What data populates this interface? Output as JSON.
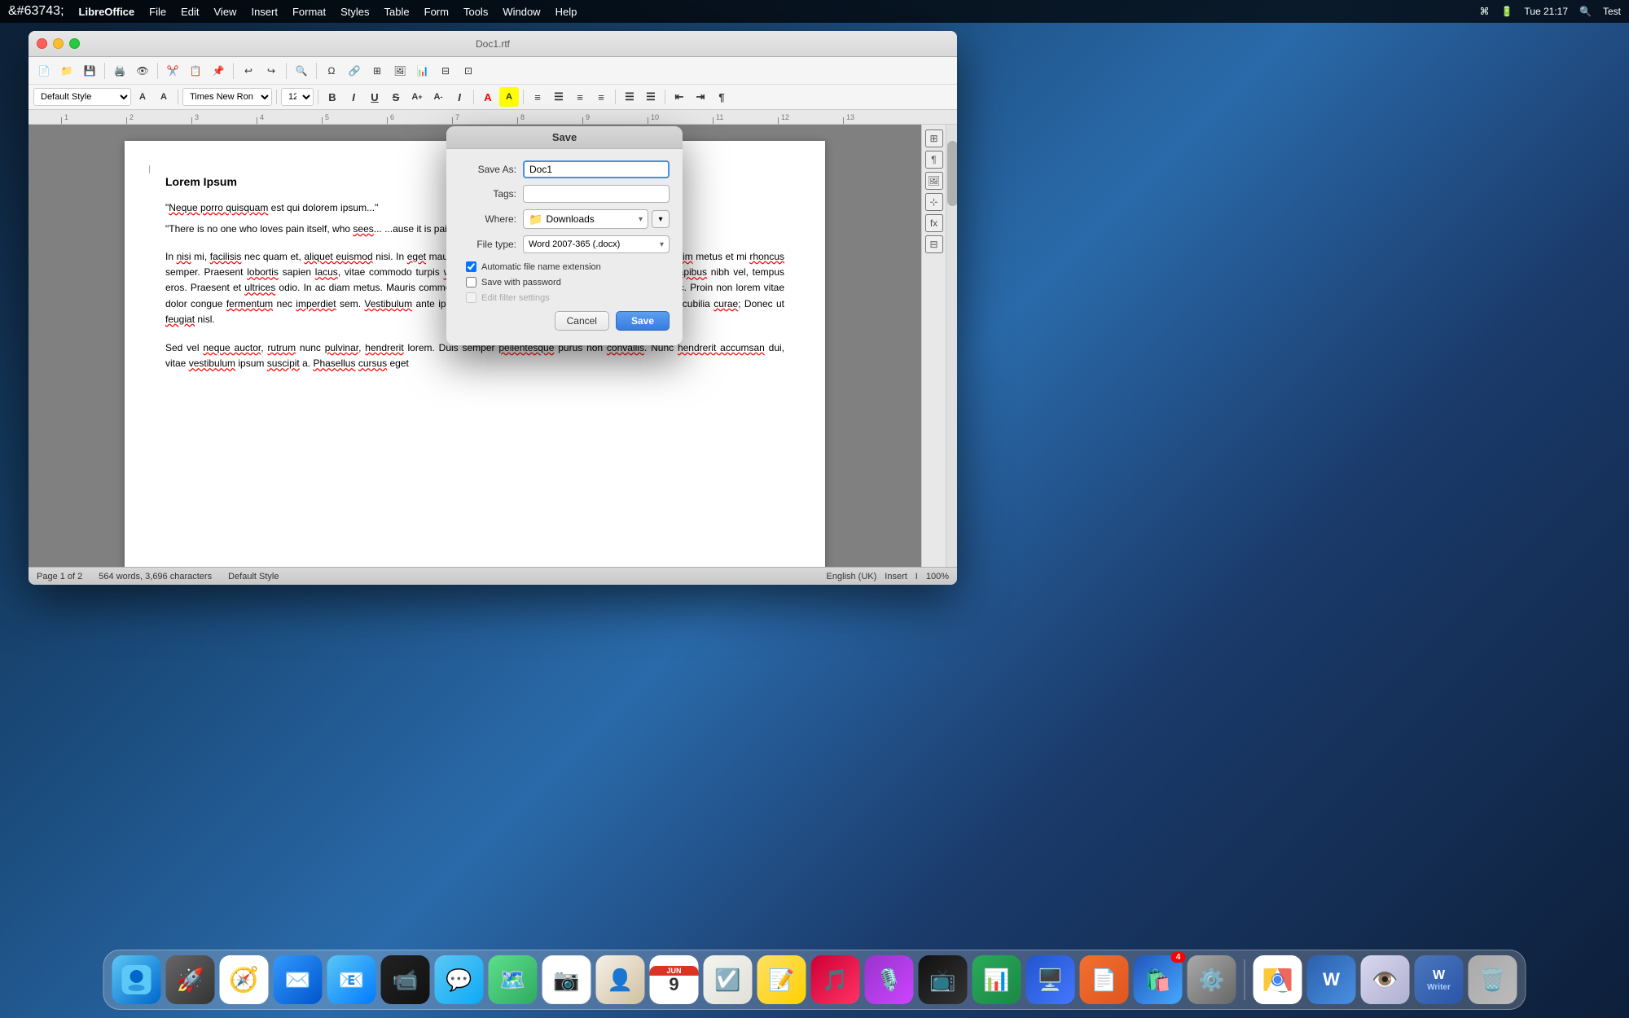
{
  "menu_bar": {
    "apple": "&#63743;",
    "app_name": "LibreOffice",
    "menus": [
      "File",
      "Edit",
      "View",
      "Insert",
      "Format",
      "Styles",
      "Table",
      "Form",
      "Tools",
      "Window",
      "Help"
    ],
    "right_items": [
      "Tue 21:17",
      "Test"
    ],
    "time": "Tue 21:17",
    "user": "Test"
  },
  "window": {
    "title": "Doc1.rtf"
  },
  "toolbar": {
    "style_select": "Default Style",
    "font_name": "Times New Ron",
    "font_size": "12"
  },
  "document": {
    "heading": "Lorem Ipsum",
    "quote1": "\"Neque porro quisquam est qui dolorem ipsum...",
    "quote2": "\"There is no one who loves pain itself, who sees... ...ause it is pain...\"",
    "body": "In nisi mi, facilisis nec quam et, aliquet euismod nisi. In eget mauris congue, faucibus turpis ut, dictum orci. Sed dignissim metus et mi rhoncus semper. Praesent lobortis sapien lacus, vitae commodo turpis venenatis nec. Vestibulum sit amet lectus volutpat, dapibus nibh vel, tempus eros. Praesent et ultrices odio. In ac diam metus. Mauris commodo venenatis mauris ut rutrum. Donec at auctor nunc. Proin non lorem vitae dolor congue fermentum nec imperdiet sem. Vestibulum ante ipsum primis in faucibus orci luctus et ultrices posuere cubilia curae; Donec ut feugiat nisl.",
    "body2": "Sed vel neque auctor, rutrum nunc pulvinar, hendrerit lorem. Duis semper pellentesque purus non convallis. Nunc hendrerit accumsan dui, vitae vestibulum ipsum suscipit a. Phasellus cursus eget"
  },
  "status_bar": {
    "page_info": "Page 1 of 2",
    "word_count": "564 words, 3,696 characters",
    "style": "Default Style",
    "language": "English (UK)",
    "mode": "Insert",
    "zoom": "100%"
  },
  "save_dialog": {
    "title": "Save",
    "save_as_label": "Save As:",
    "save_as_value": "Doc1",
    "tags_label": "Tags:",
    "tags_value": "",
    "where_label": "Where:",
    "where_value": "Downloads",
    "filetype_label": "File type:",
    "filetype_value": "Word 2007-365 (.docx)",
    "checkbox1_label": "Automatic file name extension",
    "checkbox1_checked": true,
    "checkbox2_label": "Save with password",
    "checkbox2_checked": false,
    "checkbox3_label": "Edit filter settings",
    "checkbox3_checked": false,
    "cancel_label": "Cancel",
    "save_label": "Save"
  },
  "dock": {
    "icons": [
      {
        "name": "finder",
        "emoji": "🔵",
        "label": "Finder"
      },
      {
        "name": "launchpad",
        "emoji": "🚀",
        "label": "Launchpad"
      },
      {
        "name": "safari",
        "emoji": "🧭",
        "label": "Safari"
      },
      {
        "name": "mail",
        "emoji": "✉️",
        "label": "Mail"
      },
      {
        "name": "facetime",
        "emoji": "📹",
        "label": "FaceTime"
      },
      {
        "name": "messages",
        "emoji": "💬",
        "label": "Messages"
      },
      {
        "name": "maps",
        "emoji": "🗺️",
        "label": "Maps"
      },
      {
        "name": "photos",
        "emoji": "📷",
        "label": "Photos"
      },
      {
        "name": "contacts",
        "emoji": "👤",
        "label": "Contacts"
      },
      {
        "name": "calendar",
        "emoji": "📅",
        "label": "Calendar"
      },
      {
        "name": "reminders",
        "emoji": "☑️",
        "label": "Reminders"
      },
      {
        "name": "notes",
        "emoji": "📝",
        "label": "Notes"
      },
      {
        "name": "music",
        "emoji": "🎵",
        "label": "Music"
      },
      {
        "name": "podcasts",
        "emoji": "🎙️",
        "label": "Podcasts"
      },
      {
        "name": "tv",
        "emoji": "📺",
        "label": "TV"
      },
      {
        "name": "numbers",
        "emoji": "📊",
        "label": "Numbers"
      },
      {
        "name": "keynote",
        "emoji": "🖥️",
        "label": "Keynote"
      },
      {
        "name": "pages",
        "emoji": "📄",
        "label": "Pages"
      },
      {
        "name": "appstore",
        "emoji": "🛍️",
        "label": "App Store",
        "badge": "4"
      },
      {
        "name": "prefs",
        "emoji": "⚙️",
        "label": "System Preferences"
      },
      {
        "name": "chrome",
        "emoji": "🌐",
        "label": "Google Chrome"
      },
      {
        "name": "word",
        "emoji": "W",
        "label": "Word"
      },
      {
        "name": "preview",
        "emoji": "👁️",
        "label": "Preview"
      },
      {
        "name": "lo-writer",
        "emoji": "W",
        "label": "LibreOffice Writer"
      },
      {
        "name": "trash",
        "emoji": "🗑️",
        "label": "Trash"
      }
    ]
  }
}
